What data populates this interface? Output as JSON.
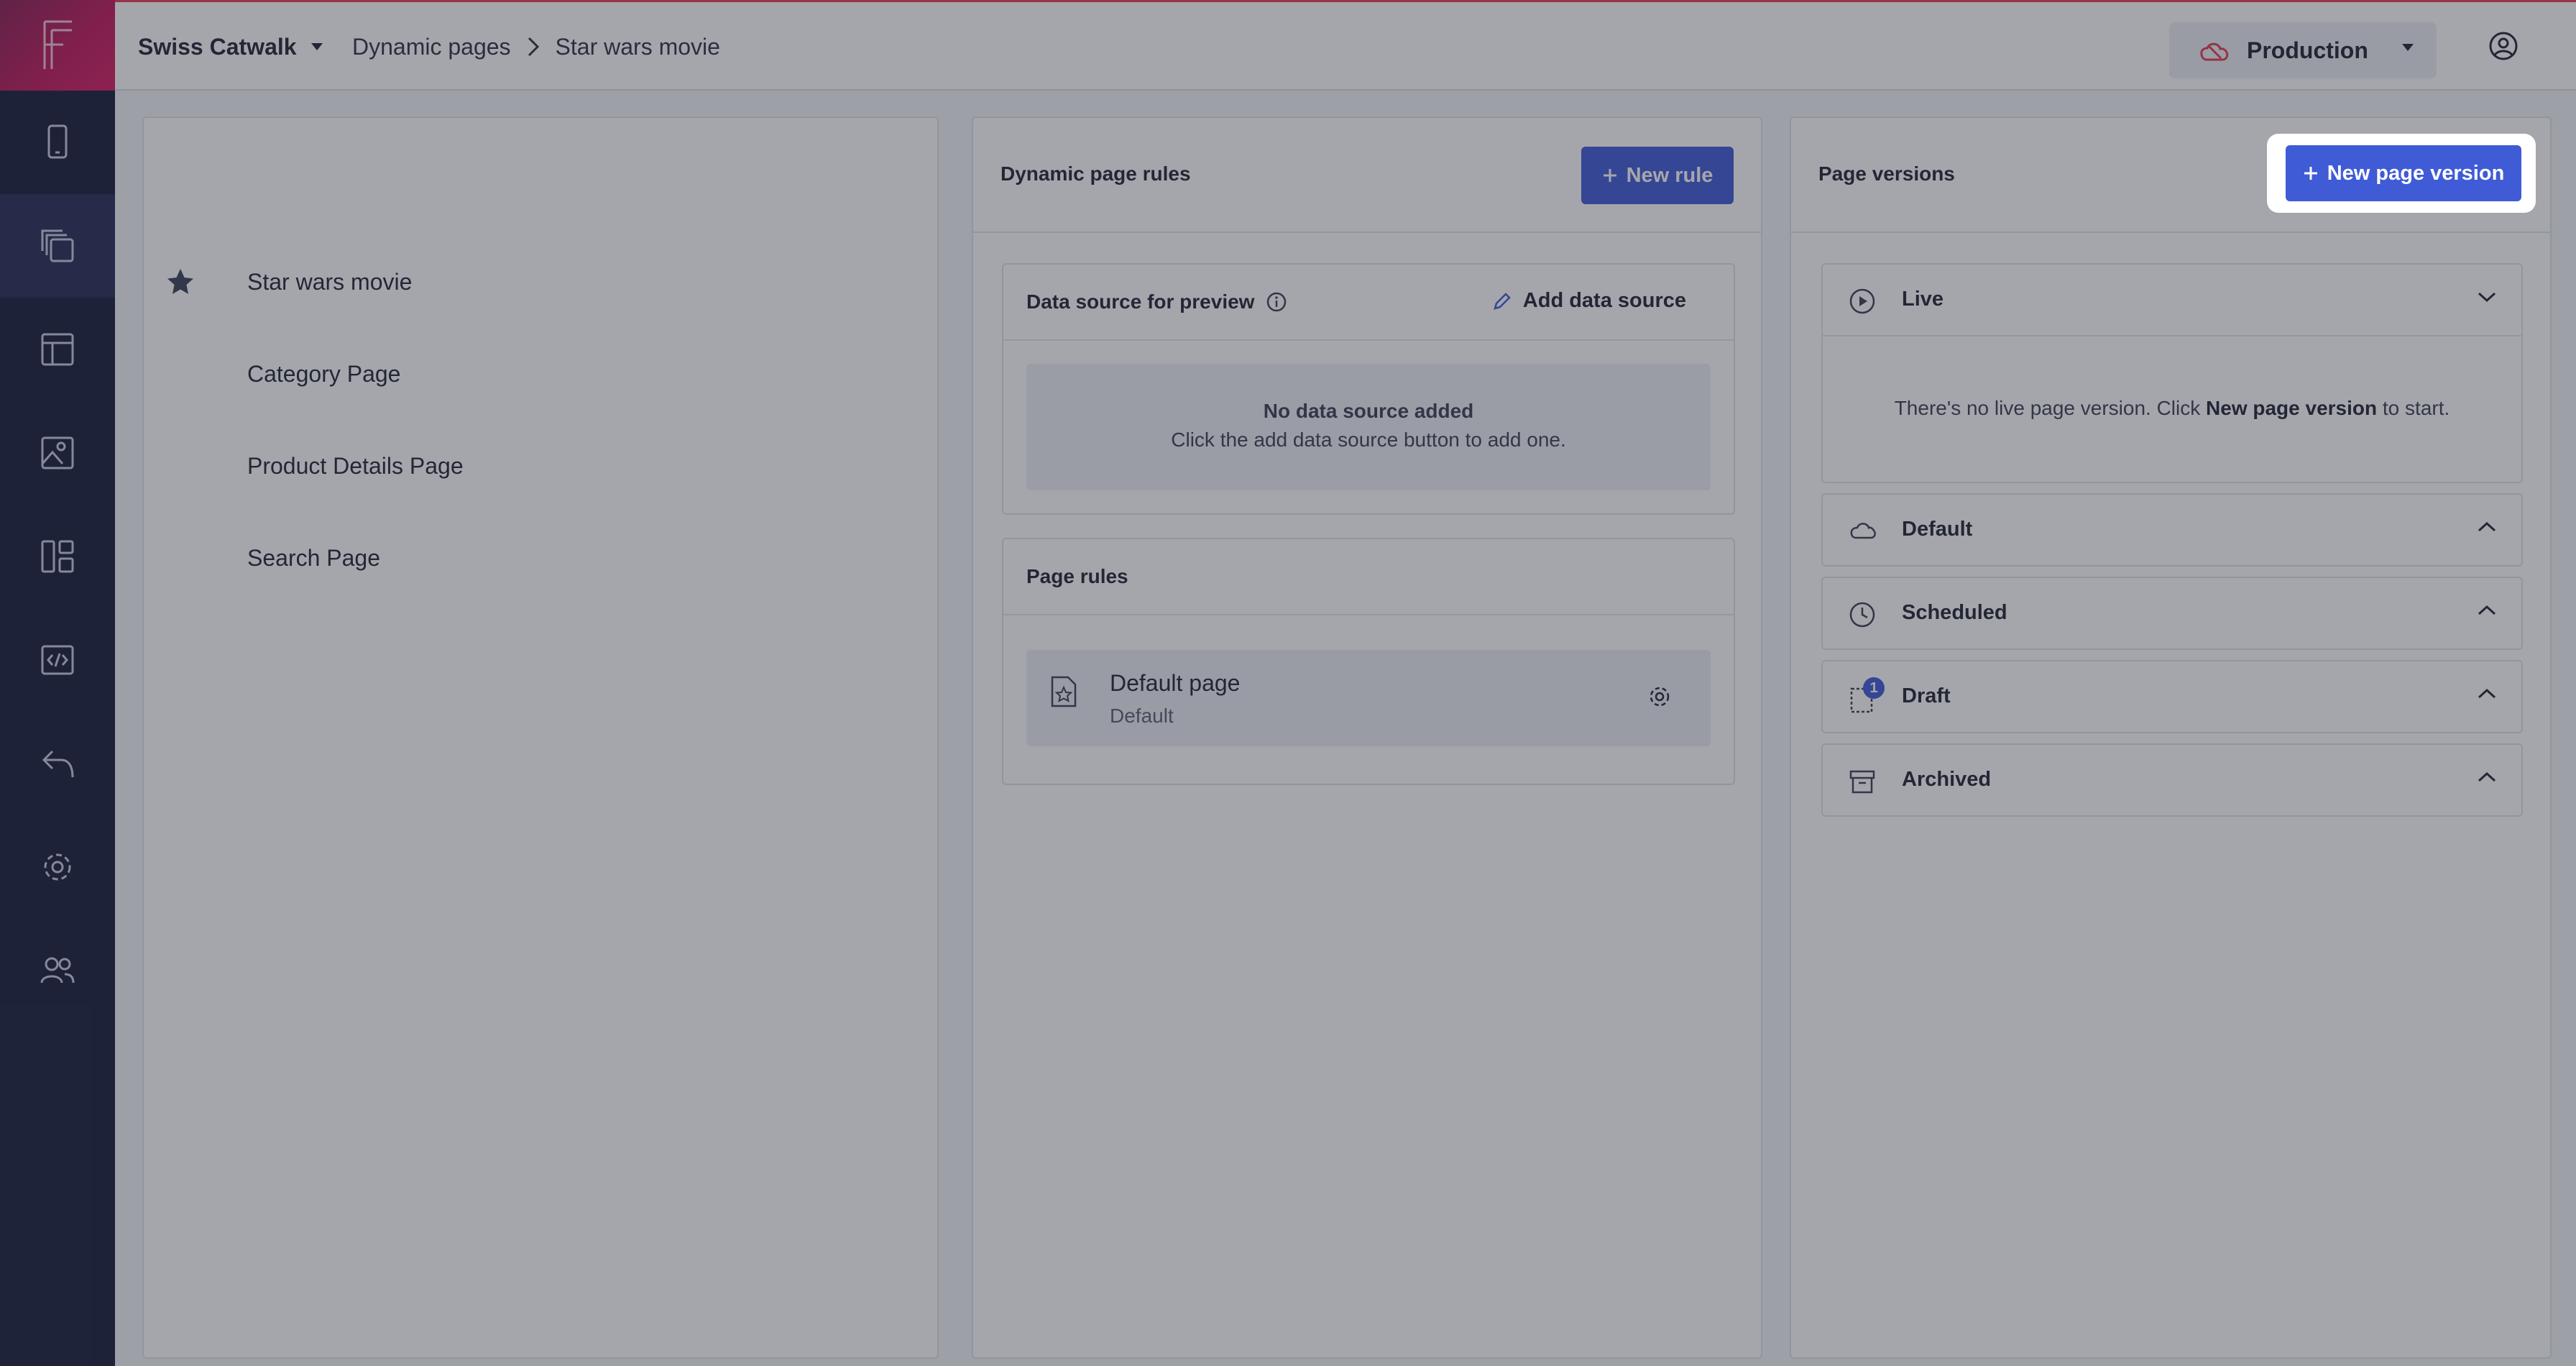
{
  "header": {
    "workspace": "Swiss Catwalk",
    "breadcrumb": [
      "Dynamic pages",
      "Star wars movie"
    ],
    "environment": "Production"
  },
  "sidebar": {
    "items": [
      {
        "icon": "mobile-icon"
      },
      {
        "icon": "pages-icon",
        "active": true
      },
      {
        "icon": "layout-icon"
      },
      {
        "icon": "image-icon"
      },
      {
        "icon": "components-icon"
      },
      {
        "icon": "code-icon"
      },
      {
        "icon": "undo-icon"
      },
      {
        "icon": "settings-icon"
      },
      {
        "icon": "users-icon"
      }
    ]
  },
  "pages": {
    "items": [
      {
        "label": "Star wars movie",
        "starred": true
      },
      {
        "label": "Category Page"
      },
      {
        "label": "Product Details Page"
      },
      {
        "label": "Search Page"
      }
    ]
  },
  "rules_panel": {
    "title": "Dynamic page rules",
    "new_rule": "New rule",
    "data_source": {
      "title": "Data source for preview",
      "add_label": "Add data source",
      "empty_title": "No data source added",
      "empty_sub": "Click the add data source button to add one."
    },
    "page_rules": {
      "title": "Page rules",
      "rule_name": "Default page",
      "rule_sub": "Default"
    }
  },
  "versions_panel": {
    "title": "Page versions",
    "new_version": "New page version",
    "live": {
      "label": "Live",
      "empty_prefix": "There's no live page version. Click ",
      "empty_bold": "New page version",
      "empty_suffix": " to start."
    },
    "groups": [
      {
        "label": "Default",
        "icon": "cloud-icon"
      },
      {
        "label": "Scheduled",
        "icon": "clock-icon"
      },
      {
        "label": "Draft",
        "icon": "draft-icon",
        "badge": "1"
      },
      {
        "label": "Archived",
        "icon": "archive-icon"
      }
    ]
  },
  "colors": {
    "sidebar": "#161c3a",
    "accent": "#3f5bd6",
    "logo": "#c2185b",
    "env_cloud": "#e53950"
  }
}
